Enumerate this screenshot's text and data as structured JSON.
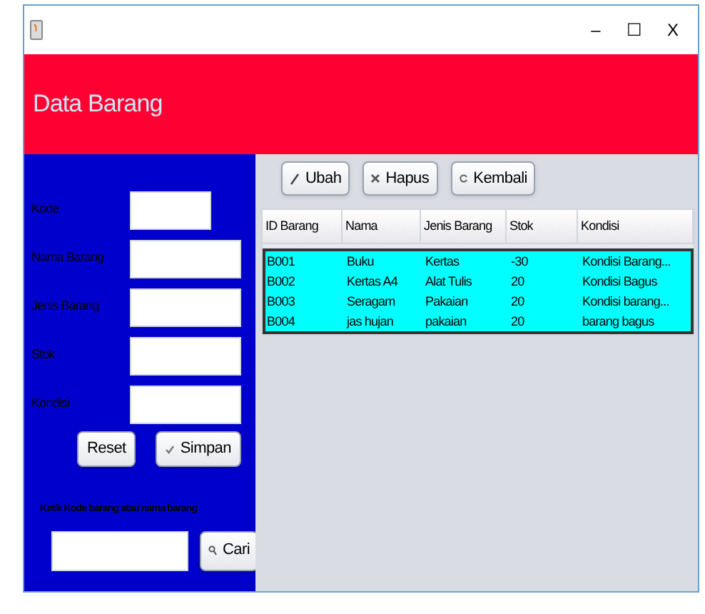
{
  "window": {
    "controls": [
      "–",
      "☐",
      "X"
    ]
  },
  "header": {
    "title": "Data Barang"
  },
  "form": {
    "fields": [
      {
        "label": "Kode"
      },
      {
        "label": "Nama Barang"
      },
      {
        "label": "Jenis Barang"
      },
      {
        "label": "Stok"
      },
      {
        "label": "Kondisi"
      }
    ],
    "buttons": [
      {
        "label": "Reset",
        "kind": "plain"
      },
      {
        "label": "Simpan",
        "kind": "check"
      }
    ],
    "search_label": "Ketik Kode barang atau nama barang",
    "search": {
      "button": "Cari"
    }
  },
  "toolbar": [
    {
      "label": "Ubah",
      "kind": "pencil"
    },
    {
      "label": "Hapus",
      "kind": "cross"
    },
    {
      "label": "Kembali",
      "kind": "refresh"
    }
  ],
  "table": {
    "columns": [
      "ID Barang",
      "Nama",
      "Jenis Barang",
      "Stok",
      "Kondisi"
    ],
    "rows": [
      {
        "cells": [
          "B001",
          "Buku",
          "Kertas",
          "-30",
          "Kondisi Barang..."
        ],
        "selected": true
      },
      {
        "cells": [
          "B002",
          "Kertas A4",
          "Alat Tulis",
          "20",
          "Kondisi Bagus"
        ],
        "selected": true
      },
      {
        "cells": [
          "B003",
          "Seragam",
          "Pakaian",
          "20",
          "Kondisi barang..."
        ],
        "selected": true
      },
      {
        "cells": [
          "B004",
          "jas hujan",
          "pakaian",
          "20",
          "barang bagus"
        ],
        "selected": true
      }
    ]
  }
}
